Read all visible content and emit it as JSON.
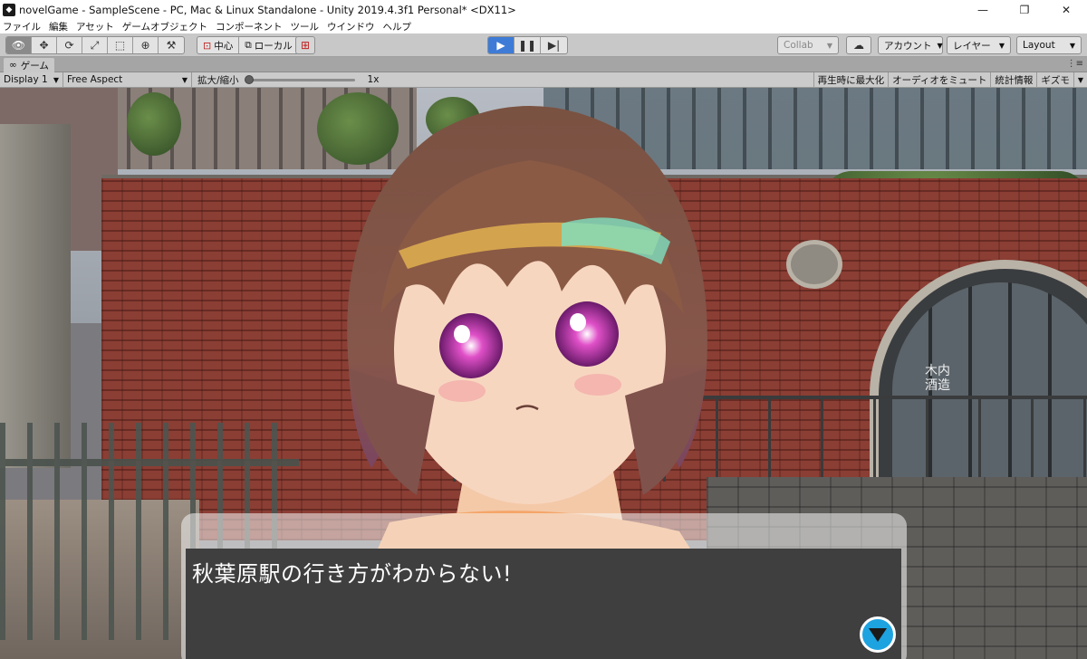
{
  "window": {
    "title": "novelGame - SampleScene - PC, Mac & Linux Standalone - Unity 2019.4.3f1 Personal* <DX11>",
    "controls": [
      "minimize",
      "restore",
      "close"
    ]
  },
  "menubar": {
    "items": [
      "ファイル",
      "編集",
      "アセット",
      "ゲームオブジェクト",
      "コンポーネント",
      "ツール",
      "ウインドウ",
      "ヘルプ"
    ]
  },
  "toolbar": {
    "transform_tools": [
      "hand-icon",
      "move-icon",
      "rotate-icon",
      "scale-icon",
      "rect-icon",
      "transform-icon",
      "custom-tool-icon"
    ],
    "pivot_label": "中心",
    "space_label": "ローカル",
    "collab_label": "Collab",
    "account_label": "アカウント",
    "layers_label": "レイヤー",
    "layout_label": "Layout"
  },
  "tab": {
    "label": "ゲーム"
  },
  "game_bar": {
    "display": "Display 1",
    "aspect": "Free Aspect",
    "scale_label": "拡大/縮小",
    "scale_value": "1x",
    "scale_fraction": 0.0,
    "maximize_on_play": "再生時に最大化",
    "mute_audio": "オーディオをミュート",
    "stats": "統計情報",
    "gizmos": "ギズモ"
  },
  "scene": {
    "sign_text": "木内酒造",
    "dialogue": "秋葉原駅の行き方がわからない!"
  },
  "colors": {
    "play_active": "#3e7bd6",
    "next_button": "#1da3e0",
    "dialogue_bg": "#3f3f3f"
  }
}
